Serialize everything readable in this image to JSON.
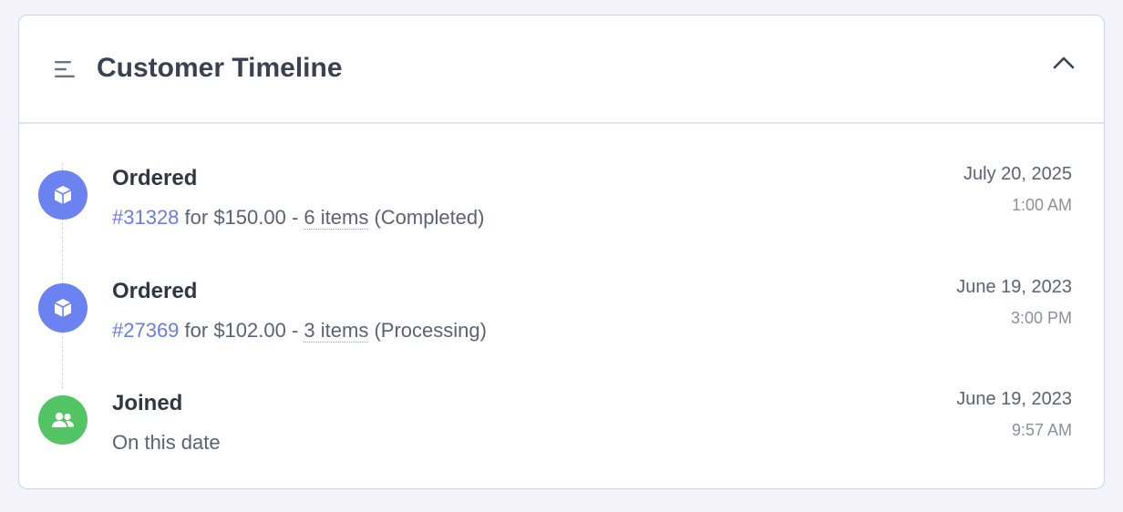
{
  "card": {
    "title": "Customer Timeline",
    "icons": {
      "header": "list-icon",
      "collapse": "chevron-up-icon"
    }
  },
  "events": [
    {
      "type": "order",
      "title": "Ordered",
      "order_number": "#31328",
      "for_text": " for $150.00 - ",
      "items_text": "6 items",
      "status_text": " (Completed)",
      "date": "July 20, 2025",
      "time": "1:00 AM",
      "icon": "package-icon",
      "icon_color": "#6b83f0"
    },
    {
      "type": "order",
      "title": "Ordered",
      "order_number": "#27369",
      "for_text": " for $102.00 - ",
      "items_text": "3 items",
      "status_text": " (Processing)",
      "date": "June 19, 2023",
      "time": "3:00 PM",
      "icon": "package-icon",
      "icon_color": "#6b83f0"
    },
    {
      "type": "joined",
      "title": "Joined",
      "description": "On this date",
      "date": "June 19, 2023",
      "time": "9:57 AM",
      "icon": "users-icon",
      "icon_color": "#52c463"
    }
  ],
  "colors": {
    "link": "#6b7be8",
    "page_background": "#f4f3fc"
  }
}
